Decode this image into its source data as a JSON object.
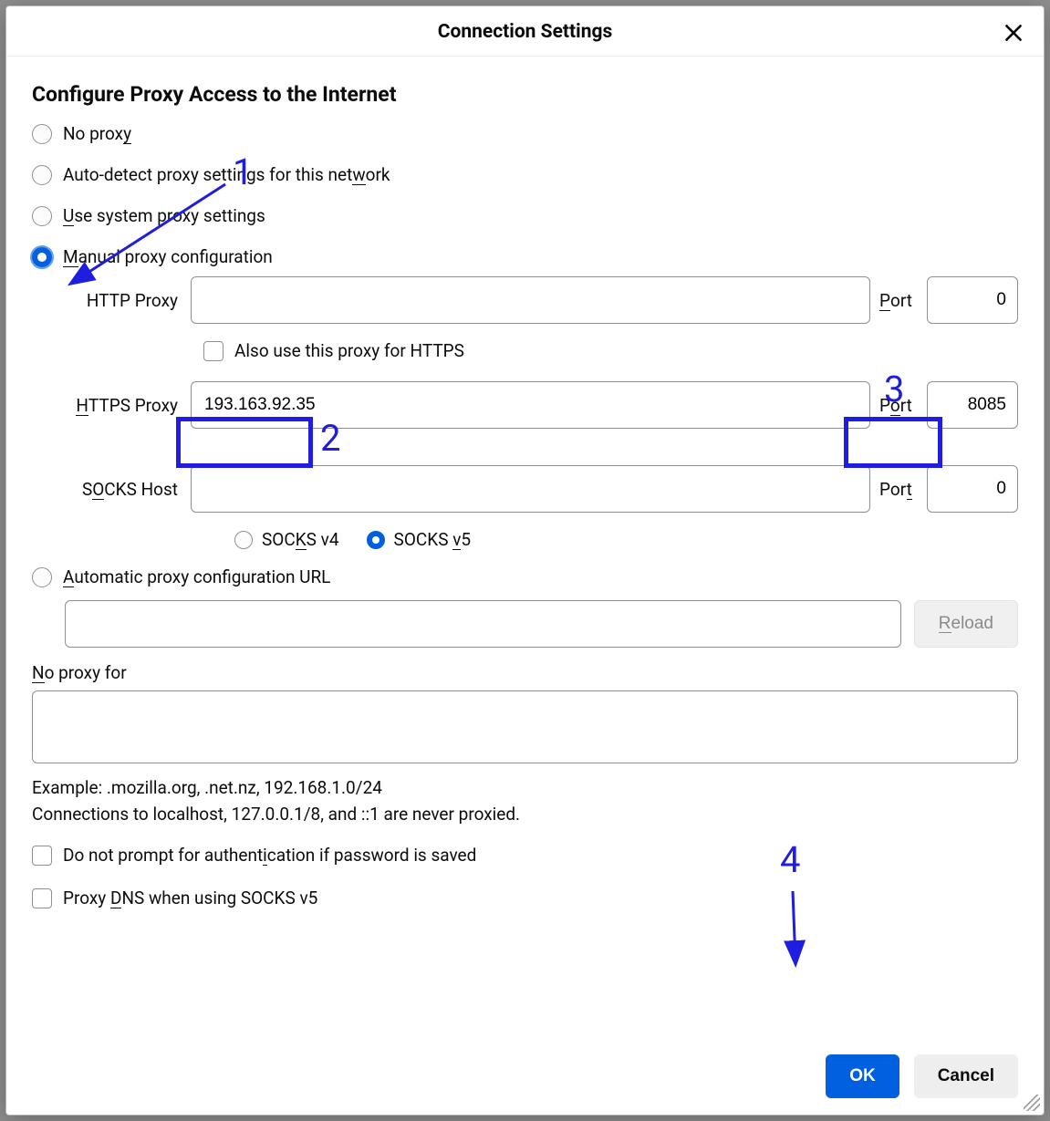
{
  "dialog": {
    "title": "Connection Settings",
    "section_title": "Configure Proxy Access to the Internet"
  },
  "radios": {
    "no_proxy": "No proxy",
    "auto_detect": "Auto-detect proxy settings for this network",
    "system": "Use system proxy settings",
    "manual": "Manual proxy configuration",
    "pac": "Automatic proxy configuration URL"
  },
  "labels": {
    "http_proxy": "HTTP Proxy",
    "https_proxy": "HTTPS Proxy",
    "socks_host": "SOCKS Host",
    "port": "Port",
    "also_https": "Also use this proxy for HTTPS",
    "socks_v4": "SOCKS v4",
    "socks_v5": "SOCKS v5",
    "reload": "Reload",
    "no_proxy_for": "No proxy for",
    "example": "Example: .mozilla.org, .net.nz, 192.168.1.0/24",
    "never_proxied": "Connections to localhost, 127.0.0.1/8, and ::1 are never proxied.",
    "no_prompt_auth": "Do not prompt for authentication if password is saved",
    "proxy_dns_socks5": "Proxy DNS when using SOCKS v5"
  },
  "values": {
    "http_host": "",
    "http_port": "0",
    "https_host": "193.163.92.35",
    "https_port": "8085",
    "socks_host": "",
    "socks_port": "0",
    "pac_url": "",
    "no_proxy_for": ""
  },
  "buttons": {
    "ok": "OK",
    "cancel": "Cancel"
  },
  "annotations": {
    "n1": "1",
    "n2": "2",
    "n3": "3",
    "n4": "4"
  },
  "underlines": {
    "no_proxy_y": "y",
    "auto_detect_w": "w",
    "system_u": "U",
    "manual_m": "M",
    "http_port_p": "P",
    "https_h": "H",
    "https_port_o": "o",
    "socks_host_o": "O",
    "socks_port_t": "t",
    "socks_v4_k": "K",
    "socks_v5_v": "v",
    "pac_a": "A",
    "reload_r": "R",
    "noproxy_n": "N",
    "no_prompt_i": "i",
    "proxy_dns_d": "D"
  }
}
